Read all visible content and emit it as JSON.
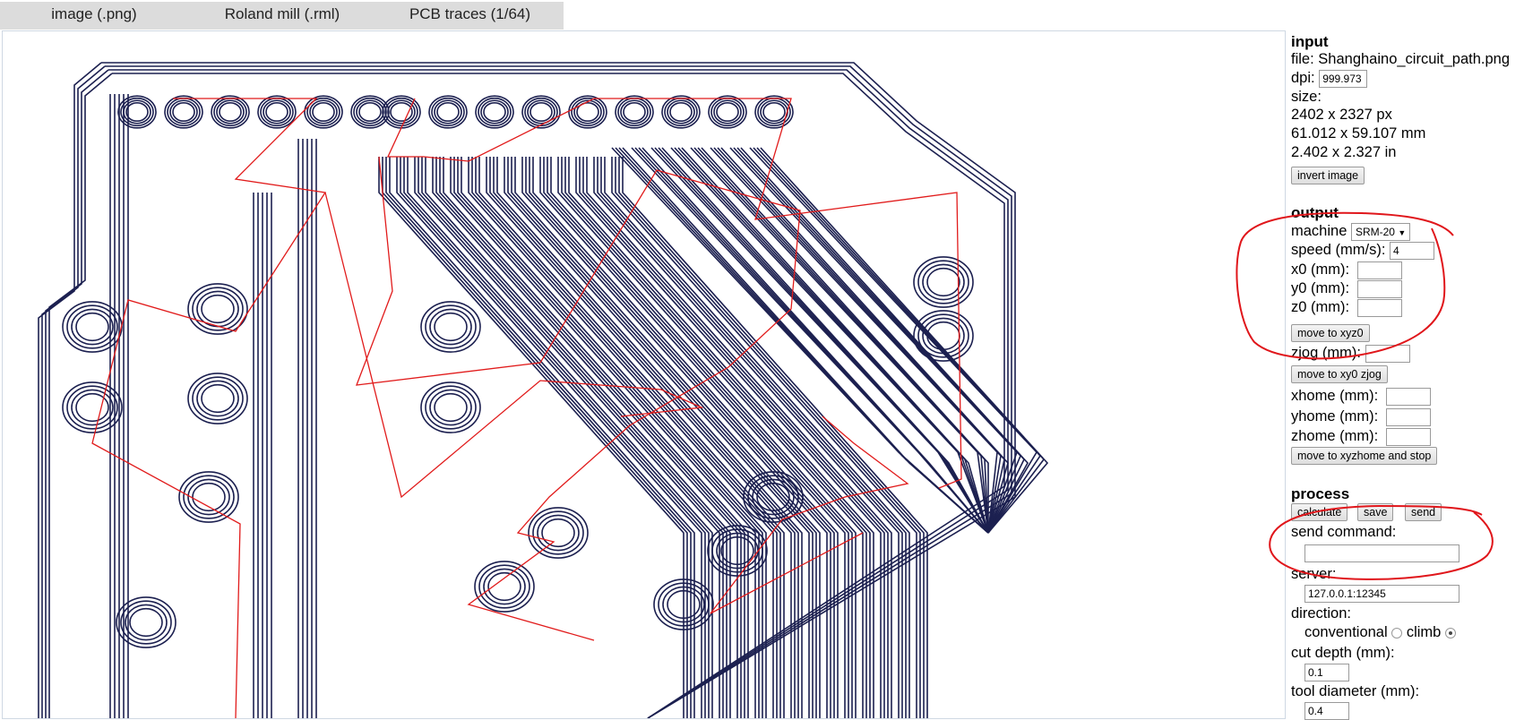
{
  "tabs": [
    "image (.png)",
    "Roland mill (.rml)",
    "PCB traces (1/64)"
  ],
  "input": {
    "heading": "input",
    "file_label": "file:",
    "file_name": "Shanghaino_circuit_path.png",
    "dpi_label": "dpi:",
    "dpi_value": "999.973",
    "size_label": "size:",
    "size_px": "2402 x 2327 px",
    "size_mm": "61.012 x 59.107 mm",
    "size_in": "2.402 x 2.327 in",
    "invert_button": "invert image"
  },
  "output": {
    "heading": "output",
    "machine_label": "machine",
    "machine_value": "SRM-20",
    "speed_label": "speed (mm/s):",
    "speed_value": "4",
    "x0_label": "x0 (mm):",
    "y0_label": "y0 (mm):",
    "z0_label": "z0 (mm):",
    "move_xyz0_button": "move to xyz0",
    "zjog_label": "zjog (mm):",
    "move_xy0_zjog_button": "move to xy0 zjog",
    "xhome_label": "xhome (mm):",
    "yhome_label": "yhome (mm):",
    "zhome_label": "zhome (mm):",
    "move_home_button": "move to xyzhome and stop"
  },
  "process": {
    "heading": "process",
    "calculate_button": "calculate",
    "save_button": "save",
    "send_button": "send",
    "send_command_label": "send command:",
    "server_label": "server:",
    "server_value": "127.0.0.1:12345",
    "direction_label": "direction:",
    "conventional_label": "conventional",
    "climb_label": "climb",
    "direction_selected": "climb",
    "cut_depth_label": "cut depth (mm):",
    "cut_depth_value": "0.1",
    "tool_diameter_label": "tool diameter (mm):",
    "tool_diameter_value": "0.4"
  },
  "colors": {
    "toolpath": "#1c2050",
    "jog_path": "#e11b1b",
    "annotation": "#e0161b",
    "tab_bg": "#dcdcdc"
  }
}
